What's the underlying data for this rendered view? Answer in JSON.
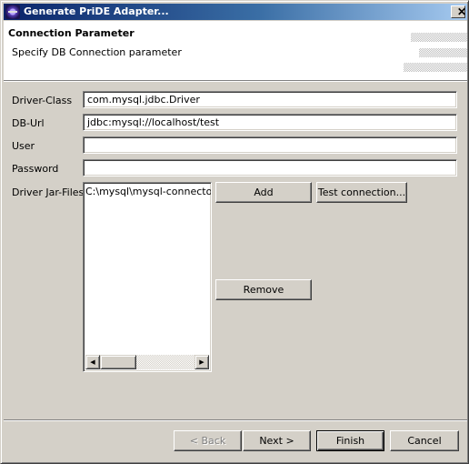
{
  "window": {
    "title": "Generate PriDE Adapter...",
    "icon": "eclipse-app-icon",
    "close_glyph": "✕"
  },
  "header": {
    "title": "Connection Parameter",
    "description": "Specify DB Connection parameter"
  },
  "form": {
    "driver_class": {
      "label": "Driver-Class",
      "value": "com.mysql.jdbc.Driver"
    },
    "db_url": {
      "label": "DB-Url",
      "value": "jdbc:mysql://localhost/test"
    },
    "user": {
      "label": "User",
      "value": ""
    },
    "password": {
      "label": "Password",
      "value": ""
    },
    "driver_jar_files": {
      "label": "Driver Jar-Files",
      "items": [
        "C:\\mysql\\mysql-connector-ja"
      ]
    }
  },
  "buttons": {
    "add": "Add",
    "test_connection": "Test connection...",
    "remove": "Remove",
    "back": "< Back",
    "next": "Next >",
    "finish": "Finish",
    "cancel": "Cancel"
  },
  "scrollbar": {
    "left_arrow": "◀",
    "right_arrow": "▶"
  }
}
